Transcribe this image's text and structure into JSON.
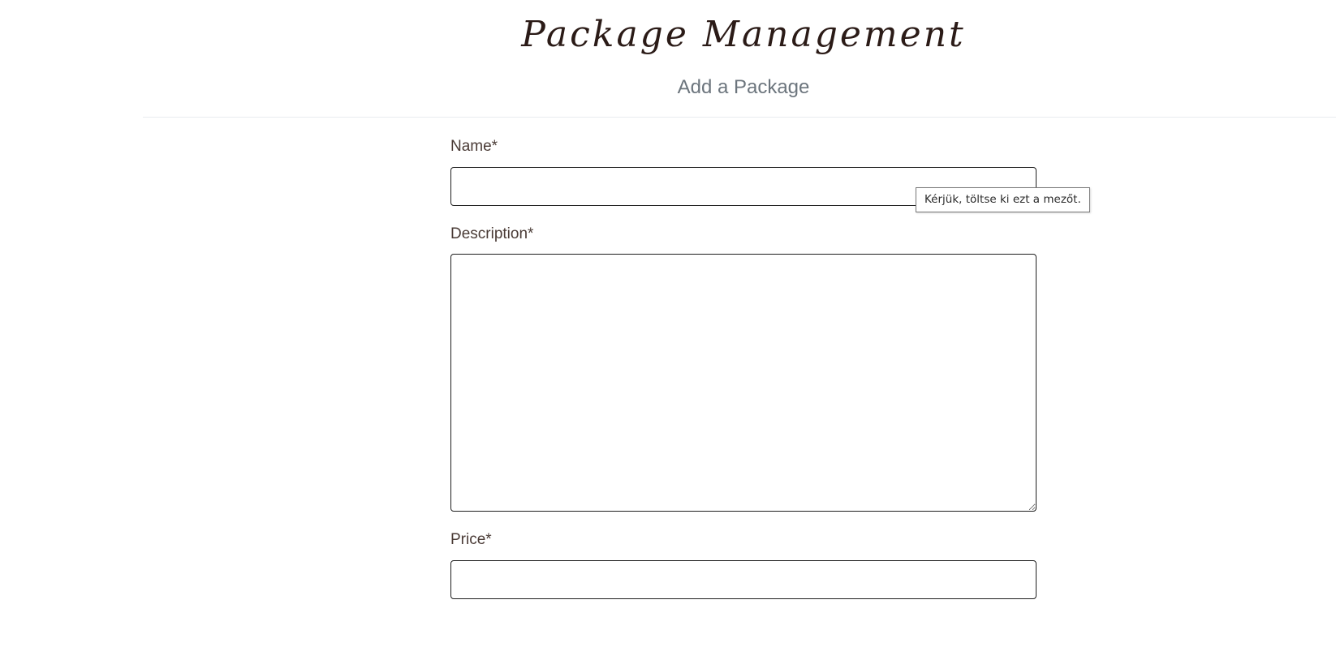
{
  "header": {
    "title": "Package Management",
    "subtitle": "Add a Package"
  },
  "form": {
    "name_label": "Name*",
    "name_value": "",
    "description_label": "Description*",
    "description_value": "",
    "price_label": "Price*",
    "price_value": ""
  },
  "tooltip": {
    "text": "Kérjük, töltse ki ezt a mezőt."
  },
  "colors": {
    "title": "#2b1b17",
    "subtitle": "#6c757d",
    "label": "#4a3b36",
    "field_border": "#1e1e1e"
  }
}
